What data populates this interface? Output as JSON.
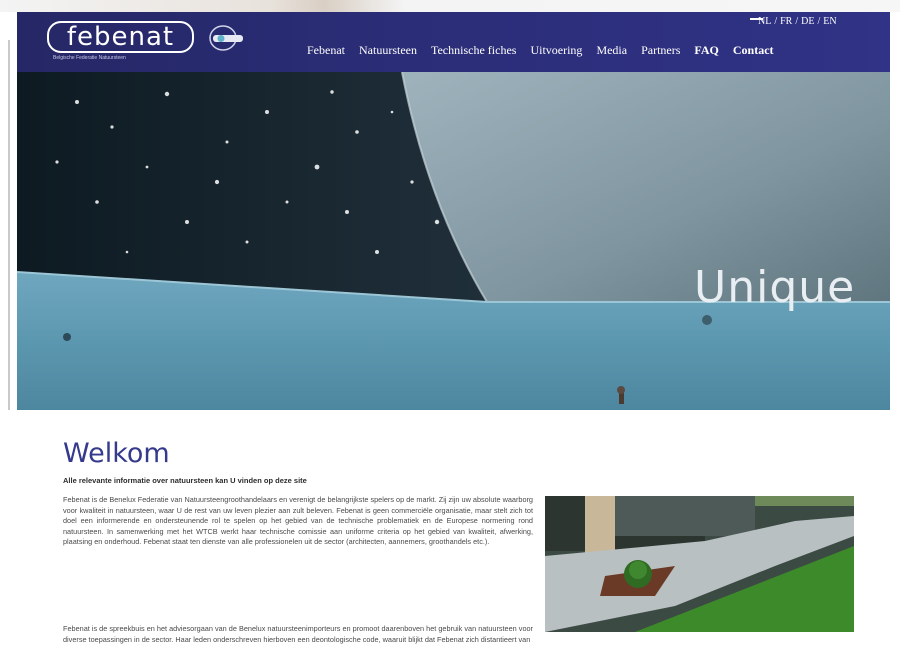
{
  "header": {
    "logo_text": "febenat",
    "logo_tagline": "Belgische Federatie Natuursteen",
    "nav": [
      {
        "label": "Febenat"
      },
      {
        "label": "Natuursteen"
      },
      {
        "label": "Technische fiches"
      },
      {
        "label": "Uitvoering"
      },
      {
        "label": "Media"
      },
      {
        "label": "Partners"
      },
      {
        "label": "FAQ"
      },
      {
        "label": "Contact"
      }
    ],
    "languages": [
      {
        "label": "NL"
      },
      {
        "label": "FR"
      },
      {
        "label": "DE"
      },
      {
        "label": "EN"
      }
    ],
    "lang_separator": "/"
  },
  "hero": {
    "text": "Unique"
  },
  "main": {
    "title": "Welkom",
    "subtitle": "Alle relevante informatie over natuursteen kan U vinden op deze site",
    "paragraph1": "Febenat is de Benelux Federatie van Natuursteengroothandelaars en verenigt de belangrijkste spelers op de markt. Zij zijn uw absolute waarborg voor kwaliteit in natuursteen, waar U de rest van uw leven plezier aan zult beleven. Febenat is geen commerciële organisatie, maar stelt zich tot doel een informerende en ondersteunende rol te spelen op het gebied van de technische problematiek en de Europese normering rond natuursteen. In samenwerking met het WTCB werkt haar technische comissie aan uniforme criteria op het gebied van kwaliteit, afwerking, plaatsing en onderhoud. Febenat staat ten dienste van alle professionelen uit de sector (architecten, aannemers, groothandels etc.).",
    "paragraph2": "Febenat is de spreekbuis en het adviesorgaan van de Benelux natuursteenimporteurs en promoot daarenboven het gebruik van natuursteen voor diverse toepassingen in de sector. Haar leden onderschreven hierboven een deontologische code, waaruit blijkt dat Febenat zich distantieert van"
  },
  "colors": {
    "header_bg": "#2b2d78",
    "title": "#353a8c"
  }
}
